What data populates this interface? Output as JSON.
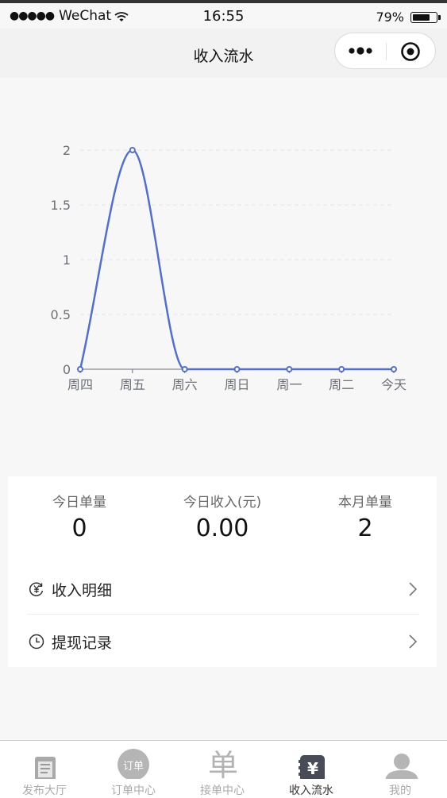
{
  "status_bar": {
    "carrier": "WeChat",
    "time": "16:55",
    "battery": "79%",
    "battery_level": 0.79
  },
  "navbar": {
    "title": "收入流水"
  },
  "chart_data": {
    "type": "line",
    "categories": [
      "周四",
      "周五",
      "周六",
      "周日",
      "周一",
      "周二",
      "今天"
    ],
    "series": [
      {
        "values": [
          0,
          2,
          0,
          0,
          0,
          0,
          0
        ]
      }
    ],
    "y_ticks": [
      "0",
      "0.5",
      "1",
      "1.5",
      "2"
    ],
    "ylim": [
      0,
      2
    ],
    "grid": true,
    "colors": {
      "line": "#5470c6",
      "grid": "#e0e6f1",
      "axis": "#6e7079",
      "label": "#6e7079"
    }
  },
  "stats": [
    {
      "label": "今日单量",
      "value": "0"
    },
    {
      "label": "今日收入(元)",
      "value": "0.00"
    },
    {
      "label": "本月单量",
      "value": "2"
    }
  ],
  "menu": [
    {
      "label": "收入明细",
      "icon": "yen-circle-icon"
    },
    {
      "label": "提现记录",
      "icon": "clock-icon"
    }
  ],
  "tabbar": {
    "items": [
      {
        "label": "发布大厅",
        "icon": "document-list-icon",
        "active": false
      },
      {
        "label": "订单中心",
        "icon": "order-badge-icon",
        "badge": "订单",
        "active": false
      },
      {
        "label": "接单中心",
        "icon": "dan-char-icon",
        "glyph": "单",
        "active": false
      },
      {
        "label": "收入流水",
        "icon": "wallet-yen-icon",
        "glyph": "¥",
        "active": true
      },
      {
        "label": "我的",
        "icon": "user-avatar-icon",
        "active": false
      }
    ]
  }
}
